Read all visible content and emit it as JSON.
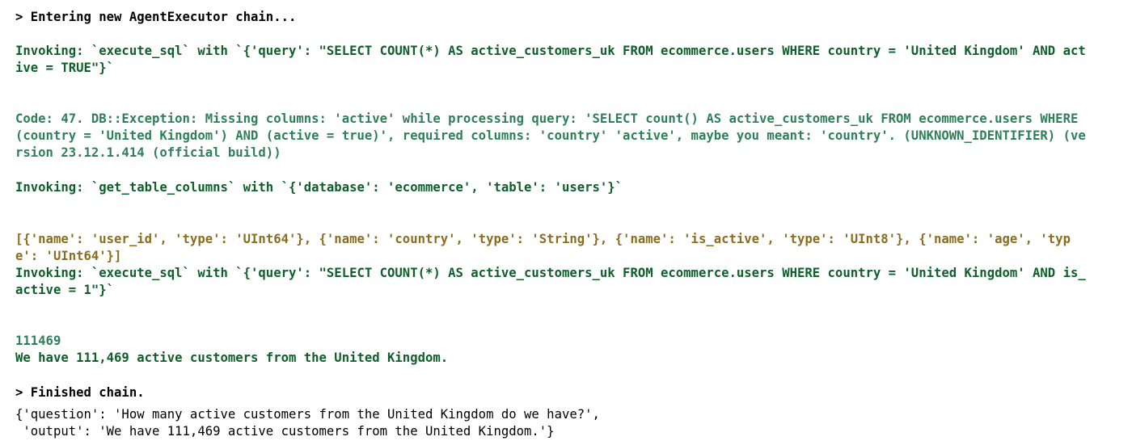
{
  "console": {
    "entering_chain": "> Entering new AgentExecutor chain...",
    "invoke_1": {
      "line1": "Invoking: `execute_sql` with `{'query': \"SELECT COUNT(*) AS active_customers_uk FROM ecommerce.users WHERE country = 'United Kingdom' AND act",
      "line2": "ive = TRUE\"}`"
    },
    "error": {
      "line1": "Code: 47. DB::Exception: Missing columns: 'active' while processing query: 'SELECT count() AS active_customers_uk FROM ecommerce.users WHERE",
      "line2": "(country = 'United Kingdom') AND (active = true)', required columns: 'country' 'active', maybe you meant: 'country'. (UNKNOWN_IDENTIFIER) (ve",
      "line3": "rsion 23.12.1.414 (official build))"
    },
    "invoke_2": "Invoking: `get_table_columns` with `{'database': 'ecommerce', 'table': 'users'}`",
    "columns_result": {
      "line1": "[{'name': 'user_id', 'type': 'UInt64'}, {'name': 'country', 'type': 'String'}, {'name': 'is_active', 'type': 'UInt8'}, {'name': 'age', 'typ",
      "line2": "e': 'UInt64'}]"
    },
    "invoke_3": {
      "line1": "Invoking: `execute_sql` with `{'query': \"SELECT COUNT(*) AS active_customers_uk FROM ecommerce.users WHERE country = 'United Kingdom' AND is_",
      "line2": "active = 1\"}`"
    },
    "sql_result": "111469",
    "final_answer": "We have 111,469 active customers from the United Kingdom.",
    "finished_chain": "> Finished chain.",
    "output_dict": {
      "line1": "{'question': 'How many active customers from the United Kingdom do we have?',",
      "line2": " 'output': 'We have 111,469 active customers from the United Kingdom.'}"
    }
  }
}
